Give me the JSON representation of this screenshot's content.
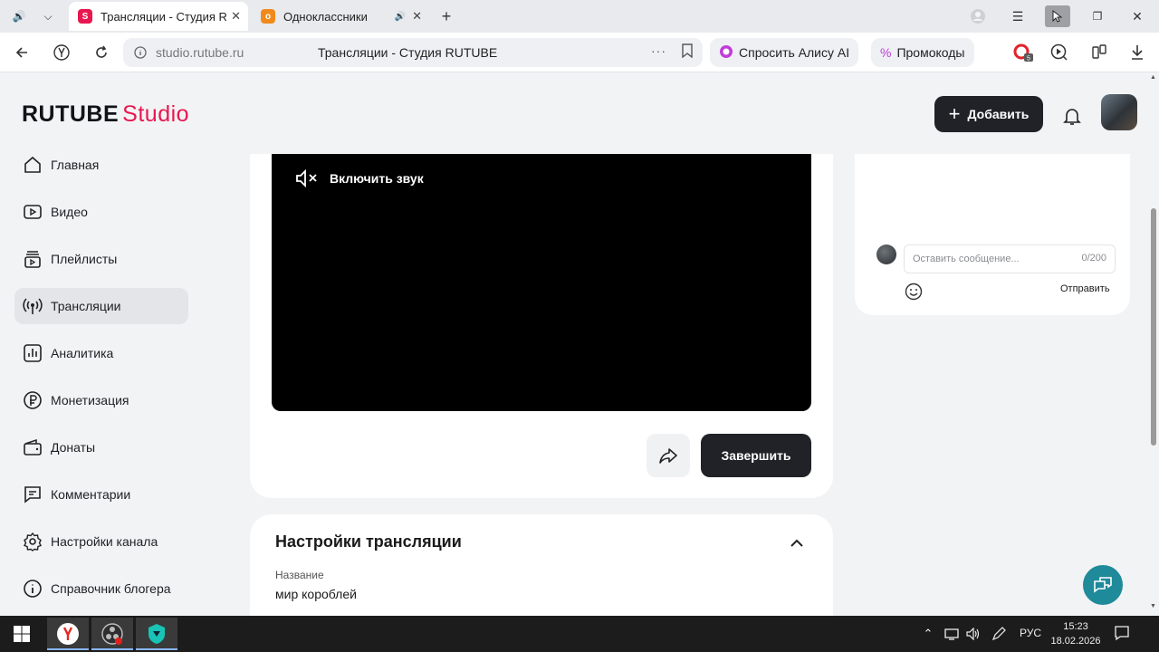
{
  "browser": {
    "tabs": [
      {
        "title": "Трансляции - Студия RUTUBE",
        "active": true
      },
      {
        "title": "Одноклассники",
        "active": false
      }
    ],
    "address": {
      "url": "studio.rutube.ru",
      "page_title": "Трансляции - Студия RUTUBE"
    },
    "alice_label": "Спросить Алису AI",
    "promo_label": "Промокоды",
    "badge_count": "5"
  },
  "header": {
    "logo_main": "RUTUBE",
    "logo_sub": "Studio",
    "add_label": "Добавить"
  },
  "sidebar": {
    "items": [
      {
        "label": "Главная",
        "icon": "home-icon"
      },
      {
        "label": "Видео",
        "icon": "video-icon"
      },
      {
        "label": "Плейлисты",
        "icon": "playlist-icon"
      },
      {
        "label": "Трансляции",
        "icon": "broadcast-icon",
        "active": true
      },
      {
        "label": "Аналитика",
        "icon": "analytics-icon"
      },
      {
        "label": "Монетизация",
        "icon": "ruble-icon"
      },
      {
        "label": "Донаты",
        "icon": "wallet-icon"
      },
      {
        "label": "Комментарии",
        "icon": "comment-icon"
      },
      {
        "label": "Настройки канала",
        "icon": "gear-icon"
      },
      {
        "label": "Справочник блогера",
        "icon": "info-icon"
      }
    ]
  },
  "player": {
    "unmute_label": "Включить звук",
    "finish_label": "Завершить"
  },
  "settings": {
    "title": "Настройки трансляции",
    "name_label": "Название",
    "name_value": "мир короблей"
  },
  "chat": {
    "placeholder": "Оставить сообщение...",
    "counter": "0/200",
    "send_label": "Отправить"
  },
  "taskbar": {
    "lang": "РУС",
    "time": "15:23",
    "date": "18.02.2026"
  },
  "colors": {
    "brand_red": "#e8174f",
    "dark_button": "#212228",
    "help_fab": "#1f8a9a"
  }
}
